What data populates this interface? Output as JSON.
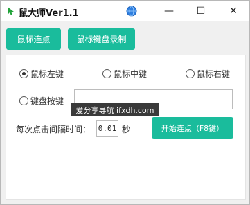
{
  "window": {
    "title": "鼠大师Ver1.1",
    "minimize": "—",
    "maximize": "☐",
    "close": "✕"
  },
  "tabs": {
    "clicker": "鼠标连点",
    "recorder": "鼠标键盘录制"
  },
  "options": {
    "left": "鼠标左键",
    "middle": "鼠标中键",
    "right": "鼠标右键",
    "key": "键盘按键",
    "selected": "left"
  },
  "interval": {
    "label": "每次点击间隔时间：",
    "value": "0.01",
    "unit": "秒"
  },
  "start_button": "开始连点（F8键）",
  "watermark": "爱分享导航 ifxdh.com",
  "colors": {
    "accent": "#1abc9c"
  }
}
